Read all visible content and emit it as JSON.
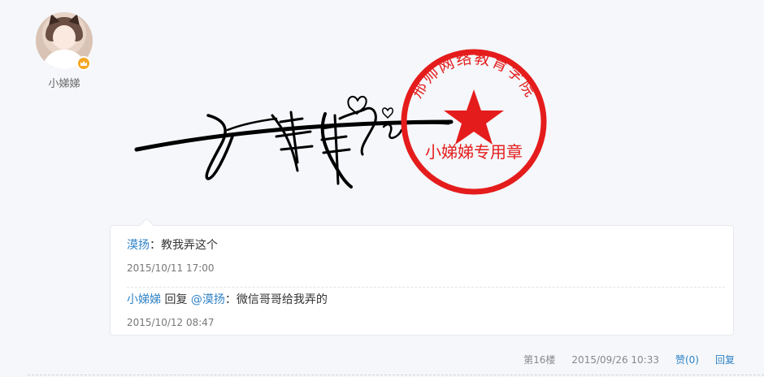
{
  "post": {
    "author": {
      "name": "小娣娣",
      "badge_icon": "crown-icon"
    },
    "signature_image": {
      "handwriting": "小娣娣",
      "stamp_arc_text": "邢帅网络教育学院",
      "stamp_center_text": "小娣娣专用章",
      "stamp_color": "#e51c1c"
    }
  },
  "replies": [
    {
      "user": "漠扬",
      "separator": "：",
      "text": "教我弄这个",
      "time": "2015/10/11 17:00"
    },
    {
      "user": "小娣娣",
      "reply_word": "回复",
      "mention": "@漠扬",
      "separator": "：",
      "text": "微信哥哥给我弄的",
      "time": "2015/10/12 08:47"
    }
  ],
  "footer": {
    "floor": "第16楼",
    "time": "2015/09/26 10:33",
    "like_label": "赞(0)",
    "reply_label": "回复"
  },
  "colors": {
    "link": "#2f82c5",
    "background": "#f5f7fa"
  }
}
